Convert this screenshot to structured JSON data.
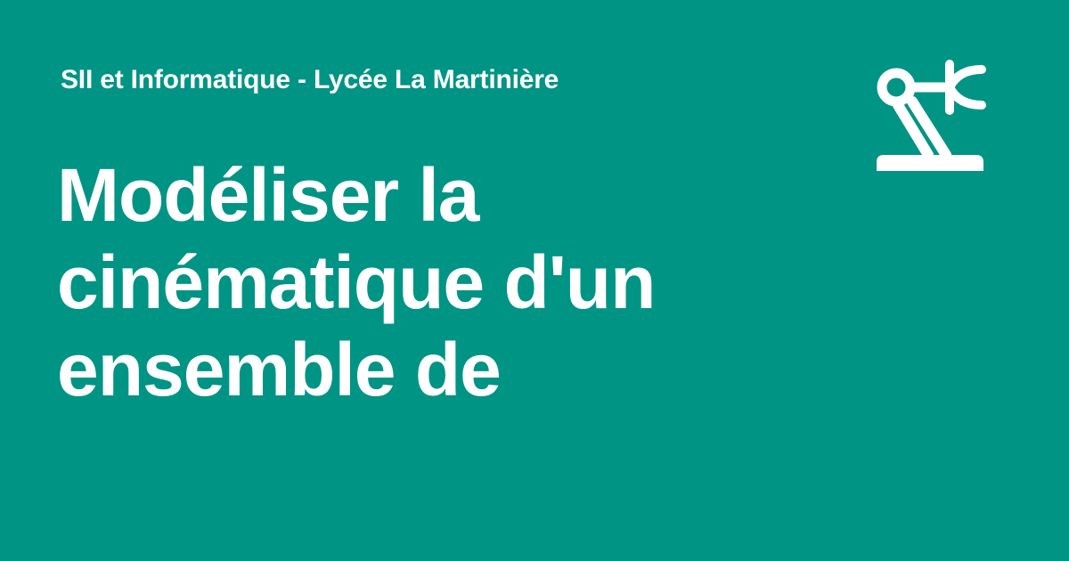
{
  "site": {
    "name": "SII et Informatique - Lycée La Martinière"
  },
  "page": {
    "title_lines": [
      "Modéliser la",
      "cinématique d'un",
      "ensemble de"
    ]
  },
  "logo": {
    "icon": "robot-arm-icon"
  },
  "colors": {
    "background": "#009485",
    "foreground": "#ffffff"
  }
}
